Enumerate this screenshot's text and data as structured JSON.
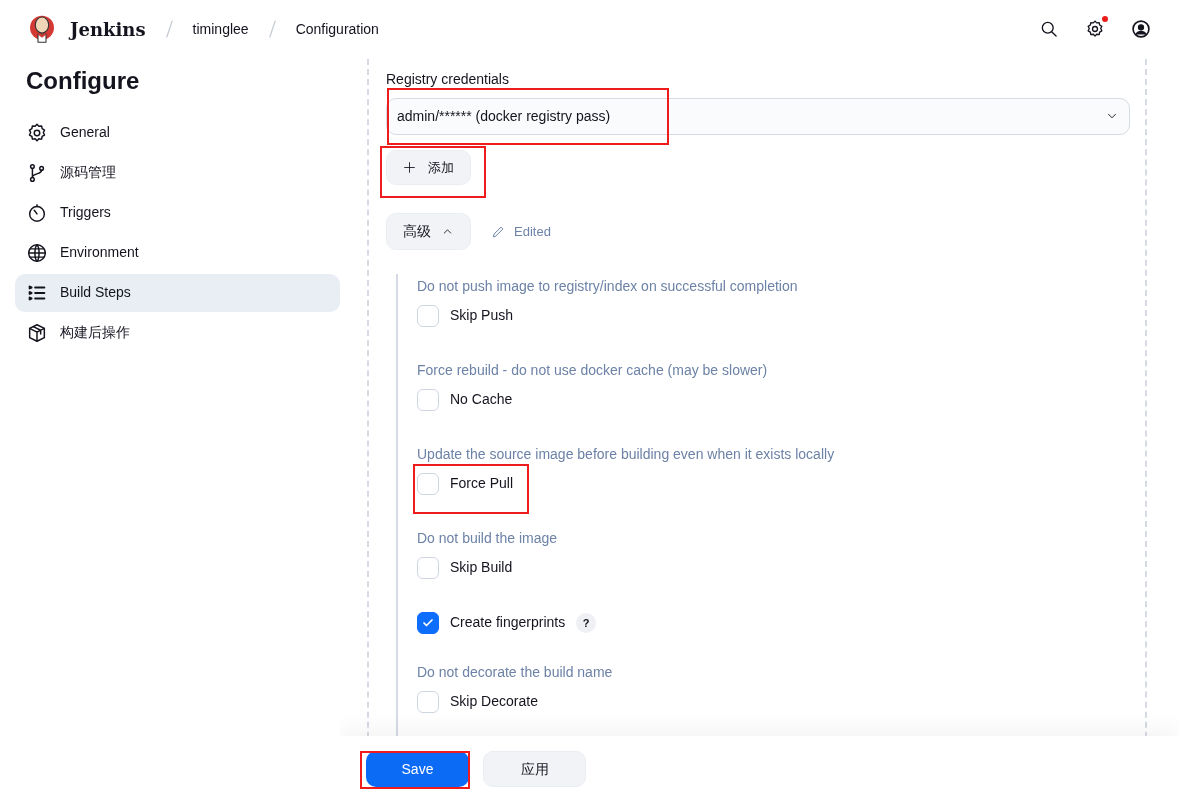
{
  "header": {
    "brand": "Jenkins",
    "breadcrumbs": [
      "timinglee",
      "Configuration"
    ],
    "settings_notification": true
  },
  "sidebar": {
    "title": "Configure",
    "items": [
      {
        "label": "General",
        "selected": false
      },
      {
        "label": "源码管理",
        "selected": false
      },
      {
        "label": "Triggers",
        "selected": false
      },
      {
        "label": "Environment",
        "selected": false
      },
      {
        "label": "Build Steps",
        "selected": true
      },
      {
        "label": "构建后操作",
        "selected": false
      }
    ]
  },
  "credentials": {
    "label": "Registry credentials",
    "value": "admin/****** (docker registry pass)",
    "highlighted": true
  },
  "add_button": {
    "label": "添加",
    "highlighted": true
  },
  "advanced": {
    "label": "高级",
    "expanded": true,
    "edited_label": "Edited"
  },
  "options": [
    {
      "hint": "Do not push image to registry/index on successful completion",
      "label": "Skip Push",
      "checked": false,
      "highlighted": false
    },
    {
      "hint": "Force rebuild - do not use docker cache (may be slower)",
      "label": "No Cache",
      "checked": false,
      "highlighted": false
    },
    {
      "hint": "Update the source image before building even when it exists locally",
      "label": "Force Pull",
      "checked": false,
      "highlighted": true
    },
    {
      "hint": "Do not build the image",
      "label": "Skip Build",
      "checked": false,
      "highlighted": false
    },
    {
      "label": "Create fingerprints",
      "checked": true,
      "help": "?",
      "highlighted": false
    },
    {
      "hint": "Do not decorate the build name",
      "label": "Skip Decorate",
      "checked": false,
      "highlighted": false
    }
  ],
  "footer": {
    "save": {
      "label": "Save",
      "highlighted": true
    },
    "apply": {
      "label": "应用"
    }
  }
}
